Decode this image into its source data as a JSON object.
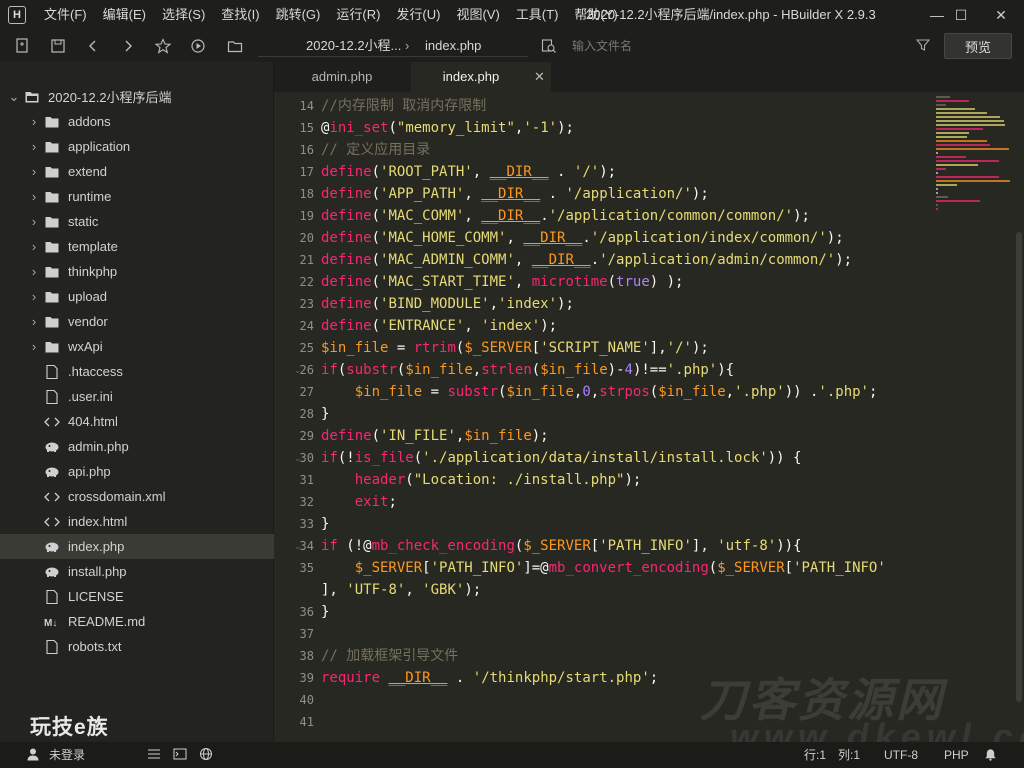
{
  "window": {
    "title": "2020-12.2小程序后端/index.php - HBuilder X 2.9.3",
    "logo": "H",
    "controls": {
      "minimize": "—",
      "maximize": "☐",
      "close": "✕"
    }
  },
  "menu": [
    "文件(F)",
    "编辑(E)",
    "选择(S)",
    "查找(I)",
    "跳转(G)",
    "运行(R)",
    "发行(U)",
    "视图(V)",
    "工具(T)",
    "帮助(Y)"
  ],
  "toolbar": {
    "breadcrumb": [
      "2020-12.2小程...",
      "index.php"
    ],
    "search_placeholder": "输入文件名",
    "preview_label": "预览"
  },
  "sidebar": {
    "root": "2020-12.2小程序后端",
    "folders": [
      "addons",
      "application",
      "extend",
      "runtime",
      "static",
      "template",
      "thinkphp",
      "upload",
      "vendor",
      "wxApi"
    ],
    "files": [
      {
        "name": ".htaccess",
        "icon": "file-icon"
      },
      {
        "name": ".user.ini",
        "icon": "file-icon"
      },
      {
        "name": "404.html",
        "icon": "code-icon"
      },
      {
        "name": "admin.php",
        "icon": "php-elephant-icon"
      },
      {
        "name": "api.php",
        "icon": "php-elephant-icon"
      },
      {
        "name": "crossdomain.xml",
        "icon": "code-icon"
      },
      {
        "name": "index.html",
        "icon": "code-icon"
      },
      {
        "name": "index.php",
        "icon": "php-elephant-icon"
      },
      {
        "name": "install.php",
        "icon": "php-elephant-icon"
      },
      {
        "name": "LICENSE",
        "icon": "file-icon"
      },
      {
        "name": "README.md",
        "icon": "markdown-icon"
      },
      {
        "name": "robots.txt",
        "icon": "file-icon"
      }
    ],
    "active_file": "index.php",
    "brand": "玩技e族"
  },
  "tabs": [
    {
      "label": "admin.php",
      "active": false
    },
    {
      "label": "index.php",
      "active": true
    }
  ],
  "editor": {
    "lines": [
      {
        "n": "14",
        "text": "//内存限制 取消内存限制"
      },
      {
        "n": "15",
        "text": "@ini_set(\"memory_limit\",'-1');"
      },
      {
        "n": "16",
        "text": "// 定义应用目录"
      },
      {
        "n": "17",
        "text": "define('ROOT_PATH', __DIR__ . '/');"
      },
      {
        "n": "18",
        "text": "define('APP_PATH', __DIR__ . '/application/');"
      },
      {
        "n": "19",
        "text": "define('MAC_COMM', __DIR__.'/application/common/common/');"
      },
      {
        "n": "20",
        "text": "define('MAC_HOME_COMM', __DIR__.'/application/index/common/');"
      },
      {
        "n": "21",
        "text": "define('MAC_ADMIN_COMM', __DIR__.'/application/admin/common/');"
      },
      {
        "n": "22",
        "text": "define('MAC_START_TIME', microtime(true) );"
      },
      {
        "n": "23",
        "text": "define('BIND_MODULE','index');"
      },
      {
        "n": "24",
        "text": "define('ENTRANCE', 'index');"
      },
      {
        "n": "25",
        "text": "$in_file = rtrim($_SERVER['SCRIPT_NAME'],'/');"
      },
      {
        "n": "26",
        "text": "if(substr($in_file,strlen($in_file)-4)!=='.php'){"
      },
      {
        "n": "27",
        "text": "    $in_file = substr($in_file,0,strpos($in_file,'.php')) .'.php';"
      },
      {
        "n": "28",
        "text": "}"
      },
      {
        "n": "29",
        "text": "define('IN_FILE',$in_file);"
      },
      {
        "n": "30",
        "text": "if(!is_file('./application/data/install/install.lock')) {"
      },
      {
        "n": "31",
        "text": "    header(\"Location: ./install.php\");"
      },
      {
        "n": "32",
        "text": "    exit;"
      },
      {
        "n": "33",
        "text": "}"
      },
      {
        "n": "34",
        "text": "if (!@mb_check_encoding($_SERVER['PATH_INFO'], 'utf-8')){"
      },
      {
        "n": "35",
        "text": "    $_SERVER['PATH_INFO']=@mb_convert_encoding($_SERVER['PATH_INFO'"
      },
      {
        "n": "",
        "text": "], 'UTF-8', 'GBK');"
      },
      {
        "n": "36",
        "text": "}"
      },
      {
        "n": "37",
        "text": ""
      },
      {
        "n": "38",
        "text": "// 加载框架引导文件"
      },
      {
        "n": "39",
        "text": "require __DIR__ . '/thinkphp/start.php';"
      },
      {
        "n": "40",
        "text": ""
      },
      {
        "n": "41",
        "text": ""
      }
    ]
  },
  "watermark": {
    "main": "刀客资源网",
    "sub": "www.dkewl.com"
  },
  "statusbar": {
    "login": "未登录",
    "row": "行:1",
    "col": "列:1",
    "encoding": "UTF-8",
    "language": "PHP"
  }
}
